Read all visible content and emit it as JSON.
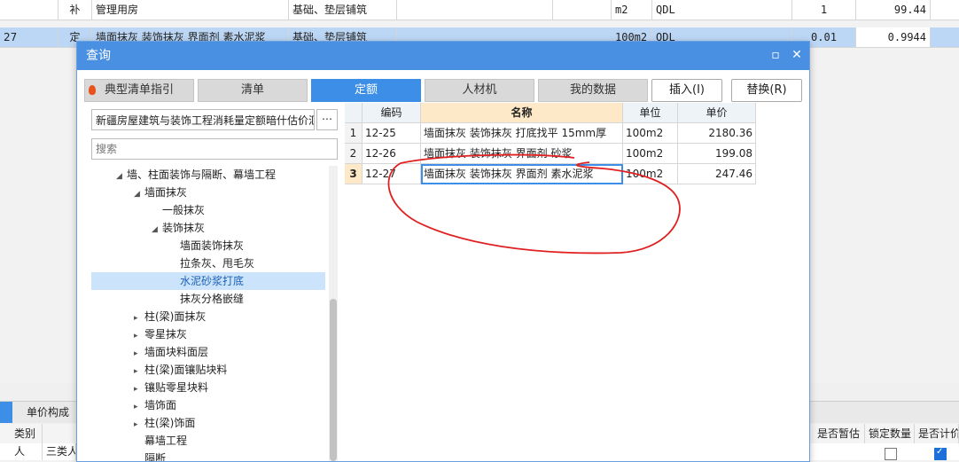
{
  "background": {
    "rows": [
      {
        "type": "补",
        "name": "管理用房",
        "feature": "基础、垫层铺筑",
        "unit": "m2",
        "code": "QDL",
        "qty": "1",
        "value": "99.44"
      },
      {
        "index": "27",
        "type": "定",
        "name": "墙面抹灰 装饰抹灰 界面剂 素水泥浆",
        "feature": "基础、垫层铺筑",
        "unit": "100m2",
        "code": "QDL",
        "qty": "0.01",
        "value": "0.9944"
      }
    ],
    "bottom_tab": "单价构成",
    "bottom_header": {
      "col1": "类别",
      "col_a": "是否暂估",
      "col_b": "锁定数量",
      "col_c": "是否计价"
    },
    "bottom_row": {
      "col1": "人",
      "col2": "三类人"
    }
  },
  "dialog": {
    "title": "查询",
    "tabs": [
      "典型清单指引",
      "清单",
      "定额",
      "人材机",
      "我的数据"
    ],
    "insert_label": "插入(I)",
    "replace_label": "替换(R)",
    "library": "新疆房屋建筑与装饰工程消耗量定额暗什估价汇",
    "search_placeholder": "搜索",
    "tree": [
      {
        "label": "墙、柱面装饰与隔断、幕墙工程",
        "expanded": true
      },
      {
        "label": "墙面抹灰",
        "expanded": true
      },
      {
        "label": "一般抹灰"
      },
      {
        "label": "装饰抹灰",
        "expanded": true
      },
      {
        "label": "墙面装饰抹灰"
      },
      {
        "label": "拉条灰、甩毛灰"
      },
      {
        "label": "水泥砂浆打底",
        "selected": true
      },
      {
        "label": "抹灰分格嵌缝"
      },
      {
        "label": "柱(梁)面抹灰"
      },
      {
        "label": "零星抹灰"
      },
      {
        "label": "墙面块料面层"
      },
      {
        "label": "柱(梁)面镶贴块料"
      },
      {
        "label": "镶贴零星块料"
      },
      {
        "label": "墙饰面"
      },
      {
        "label": "柱(梁)饰面"
      },
      {
        "label": "幕墙工程"
      },
      {
        "label": "隔断"
      }
    ],
    "table": {
      "headers": {
        "code": "编码",
        "name": "名称",
        "unit": "单位",
        "price": "单价"
      },
      "rows": [
        {
          "no": "1",
          "code": "12-25",
          "name": "墙面抹灰 装饰抹灰 打底找平 15mm厚",
          "unit": "100m2",
          "price": "2180.36"
        },
        {
          "no": "2",
          "code": "12-26",
          "name": "墙面抹灰 装饰抹灰 界面剂 砂浆",
          "unit": "100m2",
          "price": "199.08"
        },
        {
          "no": "3",
          "code": "12-27",
          "name": "墙面抹灰 装饰抹灰 界面剂 素水泥浆",
          "unit": "100m2",
          "price": "247.46"
        }
      ]
    }
  },
  "colors": {
    "accent": "#4a90e2",
    "annotation": "#e02020"
  }
}
